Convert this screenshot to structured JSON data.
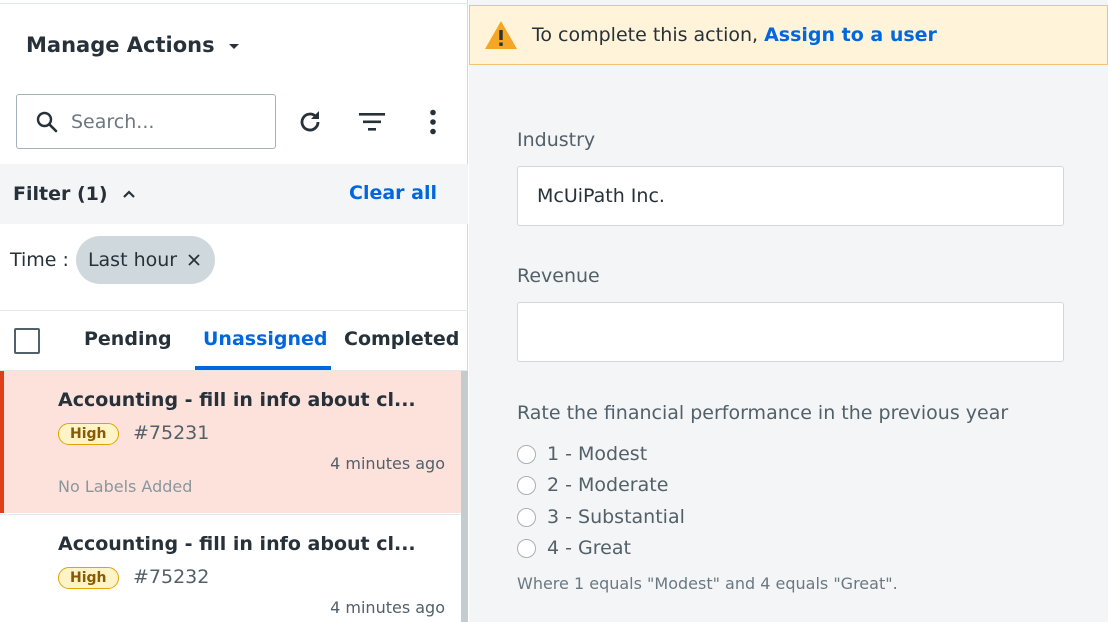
{
  "sidebar": {
    "title": "Manage Actions",
    "search_placeholder": "Search...",
    "filter_label": "Filter (1)",
    "clear_all": "Clear all",
    "time_label": "Time :",
    "time_chip": "Last hour",
    "tabs": [
      {
        "label": "Pending",
        "active": false
      },
      {
        "label": "Unassigned",
        "active": true
      },
      {
        "label": "Completed",
        "active": false
      }
    ],
    "items": [
      {
        "name": "Accounting - fill in info about cl...",
        "priority": "High",
        "number": "#75231",
        "time": "4 minutes ago",
        "labels": "No Labels Added",
        "selected": true
      },
      {
        "name": "Accounting - fill in info about cl...",
        "priority": "High",
        "number": "#75232",
        "time": "4 minutes ago",
        "selected": false
      }
    ]
  },
  "banner": {
    "message": "To complete this action,",
    "link": "Assign to a user"
  },
  "form": {
    "industry_label": "Industry",
    "industry_value": "McUiPath Inc.",
    "revenue_label": "Revenue",
    "revenue_value": "",
    "rating_label": "Rate the financial performance in the previous year",
    "rating_options": [
      "1 - Modest",
      "2 - Moderate",
      "3 - Substantial",
      "4 - Great"
    ],
    "rating_hint": "Where 1 equals \"Modest\" and 4 equals \"Great\"."
  },
  "colors": {
    "accent": "#0067df",
    "selected_bg": "#fde2dc",
    "selected_border": "#e03e1a",
    "warning_bg": "#fff4d9",
    "warning_icon": "#f5a623"
  }
}
